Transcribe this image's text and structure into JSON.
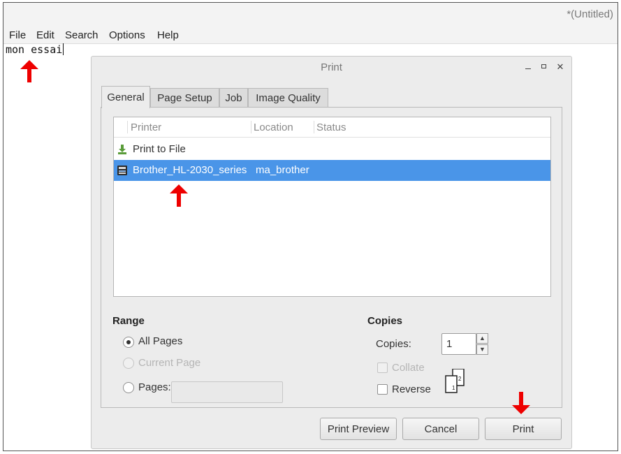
{
  "editor": {
    "title": "*(Untitled)",
    "menu": [
      "File",
      "Edit",
      "Search",
      "Options",
      "Help"
    ],
    "content": "mon essai"
  },
  "dialog": {
    "title": "Print",
    "tabs": [
      "General",
      "Page Setup",
      "Job",
      "Image Quality"
    ],
    "active_tab": "General",
    "printer_list": {
      "columns": [
        "Printer",
        "Location",
        "Status"
      ],
      "rows": [
        {
          "name": "Print to File",
          "location": "",
          "status": "",
          "icon": "print-to-file-icon",
          "selected": false
        },
        {
          "name": "Brother_HL-2030_series",
          "location": "ma_brother",
          "status": "",
          "icon": "printer-icon",
          "selected": true
        }
      ]
    },
    "range": {
      "title": "Range",
      "all_pages": "All Pages",
      "current_page": "Current Page",
      "pages": "Pages:",
      "selected": "All Pages",
      "pages_value": ""
    },
    "copies": {
      "title": "Copies",
      "label": "Copies:",
      "value": "1",
      "collate": "Collate",
      "reverse": "Reverse",
      "collate_checked": false,
      "collate_enabled": false,
      "reverse_checked": false,
      "illustration_pages": [
        "1",
        "2"
      ]
    },
    "buttons": {
      "print_preview": "Print Preview",
      "cancel": "Cancel",
      "print": "Print"
    }
  },
  "colors": {
    "selection": "#4a95e8",
    "annotation_arrow": "#ee0000"
  }
}
